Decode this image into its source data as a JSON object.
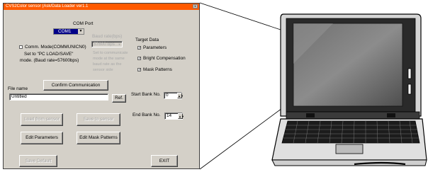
{
  "window": {
    "title": "CVS2Color sensor (Ask/Data Loader ver1.1",
    "close_glyph": "×"
  },
  "com_port": {
    "label": "COM Port",
    "value": "COM1"
  },
  "baud": {
    "value": "57600 bps",
    "label": "Baud rate(bps)"
  },
  "comm_mode": {
    "label": "Comm. Mode(COMMUNICN0)",
    "note_line1": "Set to \"PC LOAD/SAVE\"",
    "note_line2": "mode. (Baud rate=57600bps)",
    "disabled_note": [
      "Set to communicate",
      "mode at the same",
      "baud rate as the",
      "sensor side"
    ]
  },
  "target_data": {
    "label": "Target Data",
    "options": [
      {
        "label": "Parameters",
        "checked": true
      },
      {
        "label": "Bright Compensation",
        "checked": true
      },
      {
        "label": "Mask Patterns",
        "checked": true
      }
    ]
  },
  "buttons": {
    "confirm": "Confirm Communication",
    "ref": "Ref.",
    "load": "Load from sensor",
    "save": "Save to sensor",
    "edit_params": "Edit Parameters",
    "edit_mask": "Edit Mask Patterns",
    "extra": "Save Default",
    "exit": "EXIT"
  },
  "file": {
    "label": "File name",
    "value": "Untitled"
  },
  "banks": {
    "start_label": "Start Bank No.",
    "start_value": "0",
    "end_label": "End Bank No.",
    "end_value": "14"
  }
}
